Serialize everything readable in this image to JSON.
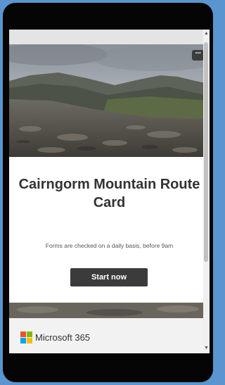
{
  "hero": {
    "image_alt": "Cairngorm mountain landscape",
    "menu_label": "···"
  },
  "card": {
    "title": "Cairngorm Mountain Route Card",
    "subtitle": "Forms are checked on a daily basis, before 9am",
    "start_label": "Start now"
  },
  "footer": {
    "brand": "Microsoft 365"
  },
  "colors": {
    "start_button": "#3b3b3b",
    "title_text": "#333333",
    "ms_red": "#f25022",
    "ms_green": "#7fba00",
    "ms_blue": "#00a4ef",
    "ms_yellow": "#ffb900"
  },
  "icons": [
    "more-options-icon",
    "microsoft-logo-icon",
    "scroll-up-arrow-icon",
    "scroll-down-arrow-icon"
  ]
}
